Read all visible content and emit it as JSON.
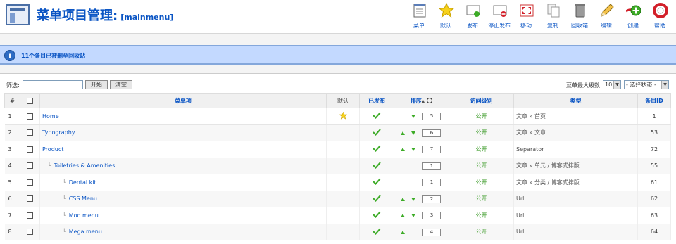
{
  "header": {
    "title": "菜单项目管理:",
    "subtitle": "[mainmenu]"
  },
  "toolbar": [
    {
      "label": "菜单",
      "icon": "menus-icon"
    },
    {
      "label": "默认",
      "icon": "default-star-icon"
    },
    {
      "label": "发布",
      "icon": "publish-icon"
    },
    {
      "label": "停止发布",
      "icon": "unpublish-icon"
    },
    {
      "label": "移动",
      "icon": "move-icon"
    },
    {
      "label": "复制",
      "icon": "copy-icon"
    },
    {
      "label": "回收箱",
      "icon": "trash-icon"
    },
    {
      "label": "编辑",
      "icon": "edit-icon"
    },
    {
      "label": "创建",
      "icon": "new-icon"
    },
    {
      "label": "帮助",
      "icon": "help-icon"
    }
  ],
  "message": {
    "text": "11个条目已被删至回收站"
  },
  "filter": {
    "label": "筛选:",
    "value": "",
    "go_label": "开始",
    "reset_label": "清空",
    "max_levels_label": "菜单最大级数",
    "max_levels_value": "10",
    "state_value": "- 选择状态 -"
  },
  "columns": {
    "num": "#",
    "item": "菜单项",
    "default": "默认",
    "published": "已发布",
    "order": "排序",
    "access": "访问级别",
    "type": "类型",
    "id": "条目ID"
  },
  "rows": [
    {
      "num": "1",
      "indent": "",
      "name": "Home",
      "default": true,
      "published": true,
      "up": false,
      "down": true,
      "order": "5",
      "access": "公开",
      "type": "文章 » 首页",
      "id": "1"
    },
    {
      "num": "2",
      "indent": "",
      "name": "Typography",
      "default": false,
      "published": true,
      "up": true,
      "down": true,
      "order": "6",
      "access": "公开",
      "type": "文章 » 文章",
      "id": "53"
    },
    {
      "num": "3",
      "indent": "",
      "name": "Product",
      "default": false,
      "published": true,
      "up": true,
      "down": true,
      "order": "7",
      "access": "公开",
      "type": "Separator",
      "id": "72"
    },
    {
      "num": "4",
      "indent": ".  └",
      "name": "Toiletries & Amenities",
      "default": false,
      "published": true,
      "up": false,
      "down": false,
      "order": "1",
      "access": "公开",
      "type": "文章 » 单元 / 博客式排版",
      "id": "55"
    },
    {
      "num": "5",
      "indent": ".  .  .  └",
      "name": "Dental kit",
      "default": false,
      "published": true,
      "up": false,
      "down": false,
      "order": "1",
      "access": "公开",
      "type": "文章 » 分类 / 博客式排版",
      "id": "61"
    },
    {
      "num": "6",
      "indent": ".  .  .  └",
      "name": "CSS Menu",
      "default": false,
      "published": true,
      "up": true,
      "down": true,
      "order": "2",
      "access": "公开",
      "type": "Url",
      "id": "62"
    },
    {
      "num": "7",
      "indent": ".  .  .  └",
      "name": "Moo menu",
      "default": false,
      "published": true,
      "up": true,
      "down": true,
      "order": "3",
      "access": "公开",
      "type": "Url",
      "id": "63"
    },
    {
      "num": "8",
      "indent": ".  .  .  └",
      "name": "Mega menu",
      "default": false,
      "published": true,
      "up": true,
      "down": false,
      "order": "4",
      "access": "公开",
      "type": "Url",
      "id": "64"
    }
  ]
}
